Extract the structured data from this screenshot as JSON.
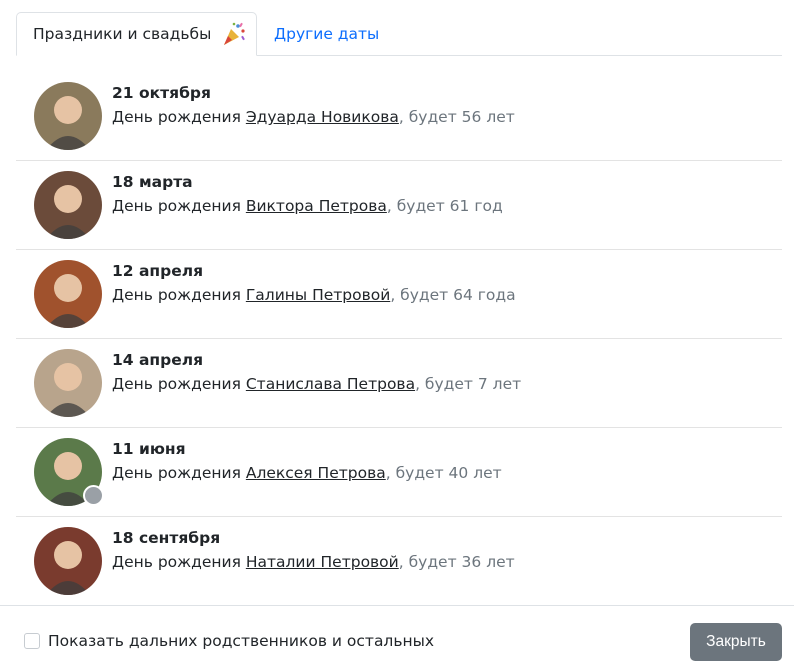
{
  "tabs": {
    "active_label": "Праздники и свадьбы",
    "active_icon": "party-popper-icon",
    "other_label": "Другие даты"
  },
  "events": [
    {
      "date": "21 октября",
      "prefix": "День рождения ",
      "name": "Эдуарда Новикова",
      "suffix": ", будет 56 лет",
      "avatar_color": "#8a7a5c"
    },
    {
      "date": "18 марта",
      "prefix": "День рождения ",
      "name": "Виктора Петрова",
      "suffix": ", будет 61 год",
      "avatar_color": "#6b4b3a"
    },
    {
      "date": "12 апреля",
      "prefix": "День рождения ",
      "name": "Галины Петровой",
      "suffix": ", будет 64 года",
      "avatar_color": "#a0522d"
    },
    {
      "date": "14 апреля",
      "prefix": "День рождения ",
      "name": "Станислава Петрова",
      "suffix": ", будет 7 лет",
      "avatar_color": "#b8a48c"
    },
    {
      "date": "11 июня",
      "prefix": "День рождения ",
      "name": "Алексея Петрова",
      "suffix": ", будет 40 лет",
      "avatar_color": "#5b7a4a"
    },
    {
      "date": "18 сентября",
      "prefix": "День рождения ",
      "name": "Наталии Петровой",
      "suffix": ", будет 36 лет",
      "avatar_color": "#7a3b2e"
    }
  ],
  "footer": {
    "checkbox_label": "Показать дальних родственников и остальных",
    "checkbox_checked": false,
    "close_label": "Закрыть"
  }
}
